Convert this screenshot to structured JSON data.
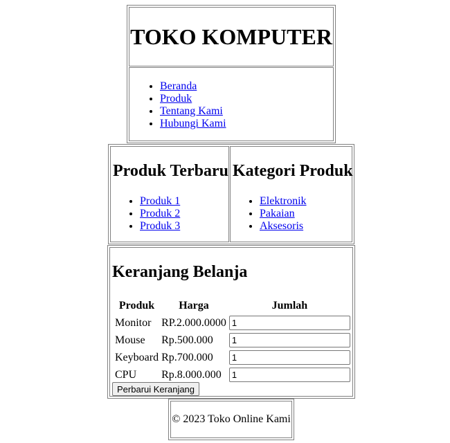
{
  "header": {
    "title": "TOKO KOMPUTER",
    "nav": [
      {
        "label": "Beranda"
      },
      {
        "label": "Produk"
      },
      {
        "label": "Tentang Kami"
      },
      {
        "label": "Hubungi Kami"
      }
    ]
  },
  "latest_products": {
    "title": "Produk Terbaru",
    "items": [
      {
        "label": "Produk 1"
      },
      {
        "label": "Produk 2"
      },
      {
        "label": "Produk 3"
      }
    ]
  },
  "categories": {
    "title": "Kategori Produk",
    "items": [
      {
        "label": "Elektronik"
      },
      {
        "label": "Pakaian"
      },
      {
        "label": "Aksesoris"
      }
    ]
  },
  "cart": {
    "title": "Keranjang Belanja",
    "columns": {
      "product": "Produk",
      "price": "Harga",
      "quantity": "Jumlah"
    },
    "rows": [
      {
        "product": "Monitor",
        "price": "RP.2.000.0000",
        "quantity": "1"
      },
      {
        "product": "Mouse",
        "price": "Rp.500.000",
        "quantity": "1"
      },
      {
        "product": "Keyboard",
        "price": "Rp.700.000",
        "quantity": "1"
      },
      {
        "product": "CPU",
        "price": "Rp.8.000.000",
        "quantity": "1"
      }
    ],
    "update_label": "Perbarui Keranjang"
  },
  "footer": {
    "text": "© 2023 Toko Online Kami"
  },
  "colors": {
    "link": "#0000ee",
    "border": "#808080"
  }
}
